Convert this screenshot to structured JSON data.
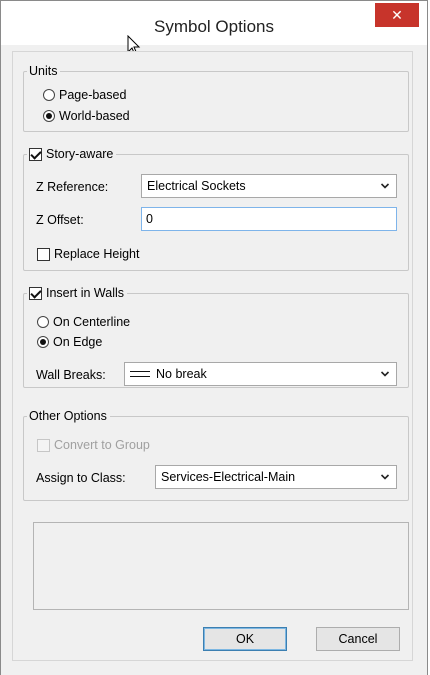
{
  "window": {
    "title": "Symbol Options",
    "close_glyph": "✕"
  },
  "units": {
    "legend": "Units",
    "options": [
      {
        "label": "Page-based",
        "selected": false
      },
      {
        "label": "World-based",
        "selected": true
      }
    ]
  },
  "story": {
    "legend": "Story-aware",
    "checked": true,
    "z_reference_label": "Z Reference:",
    "z_reference_value": "Electrical Sockets",
    "z_offset_label": "Z Offset:",
    "z_offset_value": "0",
    "replace_height_label": "Replace Height",
    "replace_height_checked": false
  },
  "walls": {
    "legend": "Insert in Walls",
    "checked": true,
    "options": [
      {
        "label": "On Centerline",
        "selected": false
      },
      {
        "label": "On Edge",
        "selected": true
      }
    ],
    "wall_breaks_label": "Wall Breaks:",
    "wall_breaks_value": "No break"
  },
  "other": {
    "legend": "Other Options",
    "convert_label": "Convert to Group",
    "convert_checked": false,
    "convert_enabled": false,
    "assign_label": "Assign to Class:",
    "assign_value": "Services-Electrical-Main"
  },
  "buttons": {
    "ok": "OK",
    "cancel": "Cancel"
  },
  "colors": {
    "close_button": "#c7342b",
    "focus_border": "#7eb4ea",
    "default_button": "#3c7fb1"
  }
}
